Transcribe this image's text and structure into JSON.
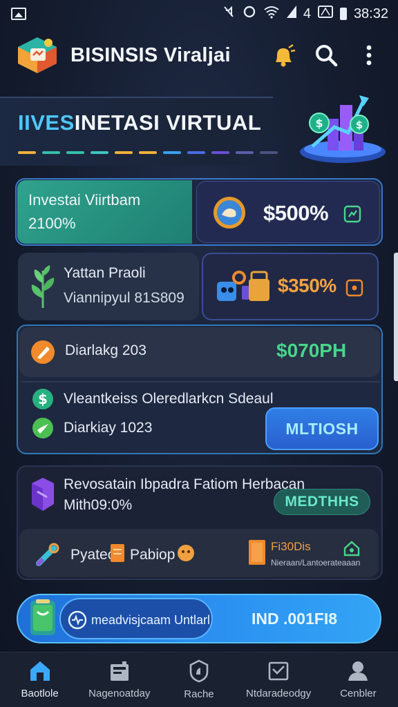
{
  "status_bar": {
    "time": "38:32",
    "signal_label": "4"
  },
  "app_bar": {
    "title": "BISINSIS Viraljai"
  },
  "hero": {
    "title_accent": "IIVES",
    "title_rest": "INETASI VIRTUAL"
  },
  "cards": {
    "investai": {
      "title": "Investai Viirtbam",
      "value": "2100%"
    },
    "balance": {
      "amount": "$500%"
    },
    "profit": {
      "title": "Yattan Praoli",
      "subtitle": "Viannipyul 81S809"
    },
    "tools": {
      "amount": "$350%"
    },
    "dividend": {
      "label": "Diarlakg 203",
      "amount": "$070PH"
    },
    "news": {
      "label": "Vleantkeiss Oleredlarkcn Sdeaul"
    },
    "daily": {
      "label": "Diarkiay 1023"
    },
    "button_one": {
      "label": "MLTIOSH"
    },
    "revo": {
      "title": "Revosatain Ibpadra Fatiom Herbacan",
      "value": "Mith09:0%"
    },
    "button_two": {
      "label": "MEDTHHS"
    },
    "mini": {
      "left_label": "Pyatec",
      "middle_label": "Pabiop",
      "right_title": "Fi30Dis",
      "right_sub": "Nieraan/Lantoerateaaan"
    }
  },
  "promo": {
    "left_label": "meadvisjcaam Untlarl",
    "right_label": "IND .001FI8"
  },
  "bottom_nav": {
    "items": [
      {
        "label": "Baotlole",
        "icon": "home-icon"
      },
      {
        "label": "Nagenoatday",
        "icon": "briefcase-icon"
      },
      {
        "label": "Rache",
        "icon": "shield-icon"
      },
      {
        "label": "Ntdaradeodgy",
        "icon": "inbox-icon"
      },
      {
        "label": "Cenbler",
        "icon": "person-icon"
      }
    ]
  },
  "colors": {
    "accent_blue": "#3a78c9",
    "teal": "#2b9e8a",
    "green": "#47d68a",
    "orange": "#f08a2c"
  }
}
